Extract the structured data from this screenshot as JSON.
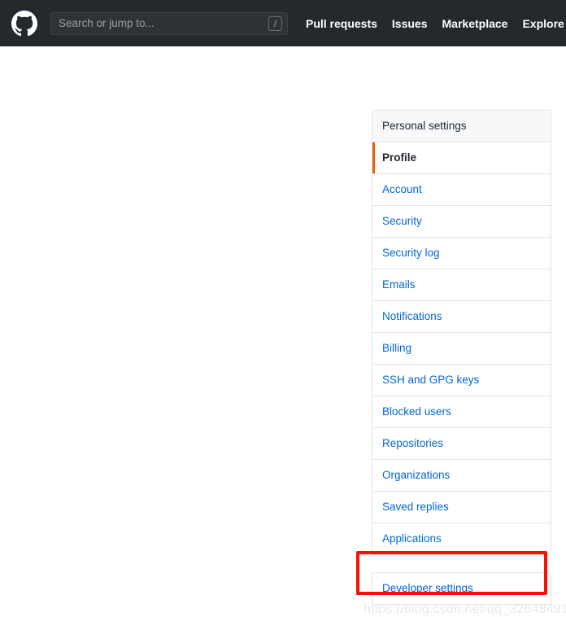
{
  "header": {
    "logo_name": "github-logo",
    "search": {
      "placeholder": "Search or jump to...",
      "value": "",
      "shortcut_badge": "/"
    },
    "nav": [
      {
        "label": "Pull requests"
      },
      {
        "label": "Issues"
      },
      {
        "label": "Marketplace"
      },
      {
        "label": "Explore"
      }
    ],
    "background_color": "#24292e"
  },
  "settings_nav": {
    "heading": "Personal settings",
    "primary_items": [
      {
        "label": "Profile",
        "selected": true
      },
      {
        "label": "Account",
        "selected": false
      },
      {
        "label": "Security",
        "selected": false
      },
      {
        "label": "Security log",
        "selected": false
      },
      {
        "label": "Emails",
        "selected": false
      },
      {
        "label": "Notifications",
        "selected": false
      },
      {
        "label": "Billing",
        "selected": false
      },
      {
        "label": "SSH and GPG keys",
        "selected": false
      },
      {
        "label": "Blocked users",
        "selected": false
      },
      {
        "label": "Repositories",
        "selected": false
      },
      {
        "label": "Organizations",
        "selected": false
      },
      {
        "label": "Saved replies",
        "selected": false
      },
      {
        "label": "Applications",
        "selected": false
      }
    ],
    "secondary_items": [
      {
        "label": "Developer settings",
        "selected": false
      }
    ],
    "link_color": "#0366d6",
    "selected_accent_color": "#e36209"
  },
  "annotation": {
    "name": "developer-settings-highlight",
    "color": "#fa0f08"
  },
  "watermark": {
    "text": "https://blog.csdn.net/qq_32648491"
  }
}
